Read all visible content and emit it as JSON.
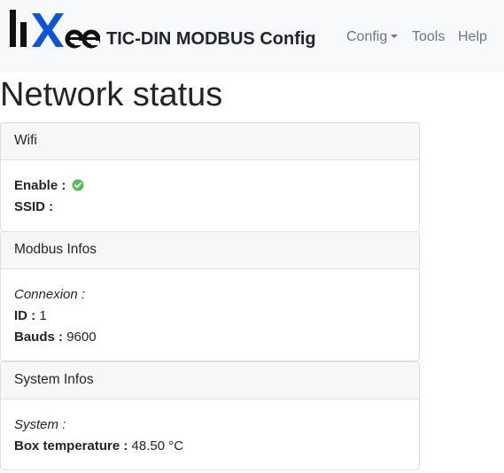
{
  "navbar": {
    "brand_title": "TIC-DIN MODBUS Config",
    "logo_text": "lixee",
    "menu": {
      "config": "Config",
      "tools": "Tools",
      "help": "Help"
    }
  },
  "page": {
    "title": "Network status"
  },
  "wifi": {
    "header": "Wifi",
    "enable_label": "Enable :",
    "enable_status_icon": "check-circle-icon",
    "ssid_label": "SSID :"
  },
  "modbus": {
    "header": "Modbus Infos",
    "connexion_label": "Connexion :",
    "id_label": "ID :",
    "id_value": "1",
    "bauds_label": "Bauds :",
    "bauds_value": "9600"
  },
  "system": {
    "header": "System Infos",
    "system_label": "System :",
    "temp_label": "Box temperature :",
    "temp_value": "48.50 °C"
  },
  "colors": {
    "navbar_bg": "#f8f9fa",
    "ok_green": "#5cb85c",
    "nav_link": "#6c757d"
  }
}
